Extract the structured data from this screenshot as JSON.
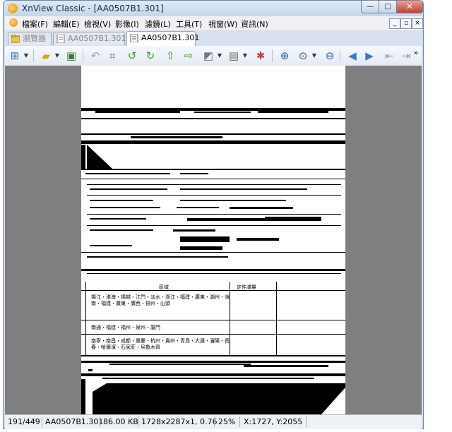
{
  "window": {
    "title": "XnView Classic - [AA0507B1.301]"
  },
  "titlebar_buttons": {
    "minimize": "—",
    "maximize": "□",
    "close": "✕"
  },
  "menu": {
    "items": [
      "檔案(F)",
      "編輯(E)",
      "檢視(V)",
      "影像(I)",
      "濾鏡(L)",
      "工具(T)",
      "視窗(W)",
      "資訊(N)"
    ]
  },
  "mdi_buttons": {
    "minimize": "_",
    "restore": "▫",
    "close": "×"
  },
  "tabs": [
    {
      "label": "瀏覽器",
      "active": false
    },
    {
      "label": "AA0507B1.301",
      "active": false
    },
    {
      "label": "AA0507B1.301",
      "active": true
    }
  ],
  "toolbar": {
    "icons": [
      "browser-icon",
      "open-folder-icon",
      "save-icon",
      "undo-icon",
      "crop-icon",
      "rotate-left-icon",
      "rotate-right-icon",
      "export-icon",
      "import-icon",
      "adjust-icon",
      "print-icon",
      "settings-icon",
      "zoom-in-icon",
      "zoom-fit-icon",
      "zoom-out-icon",
      "previous-icon",
      "next-icon",
      "first-icon",
      "last-icon"
    ],
    "overflow": "»"
  },
  "document": {
    "table_header": [
      "區域",
      "定件滿量"
    ],
    "rows": [
      "揚江・淮海・揚越・江門・淡水・浙江・福建・廣東・湖州・嶺南・福建・廣東・廣西・揚州・山頭",
      "南通・福建・福州・泉州・廈門",
      "南寧・南昌・成都・重慶・杭州・貴州・青島・大連・瀋陽・長春・哈爾濱・石家莊・烏魯木齊"
    ]
  },
  "status": {
    "index": "191/449",
    "filename": "AA0507B1.301",
    "size": "86.00 KB",
    "dimensions": "1728x2287x1, 0.76",
    "zoom": "25%",
    "coords": "X:1727, Y:2055"
  },
  "colors": {
    "frame": "#cfdcec",
    "viewer_bg": "#7f7f7f",
    "page": "#ffffff"
  }
}
